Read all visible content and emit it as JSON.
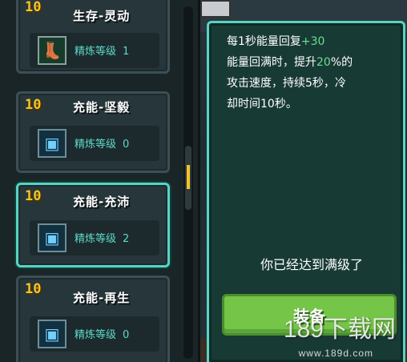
{
  "skills": [
    {
      "level": "10",
      "name": "生存-灵动",
      "refine_label": "精炼等级",
      "refine_value": "1",
      "icon": "green-boot-icon"
    },
    {
      "level": "10",
      "name": "充能-坚毅",
      "refine_label": "精炼等级",
      "refine_value": "0",
      "icon": "blue-chip-icon"
    },
    {
      "level": "10",
      "name": "充能-充沛",
      "refine_label": "精炼等级",
      "refine_value": "2",
      "icon": "blue-chip-icon"
    },
    {
      "level": "10",
      "name": "充能-再生",
      "refine_label": "精炼等级",
      "refine_value": "0",
      "icon": "blue-chip-icon"
    }
  ],
  "detail": {
    "line1_prefix": "每1秒能量回复",
    "line1_value": "+30",
    "line2_prefix": "能量回满时，提升",
    "line2_value": "20",
    "line2_suffix": "%的",
    "line3": "攻击速度，持续5秒，冷",
    "line4": "却时间10秒。",
    "maxed_text": "你已经达到满级了",
    "equip_label": "装备"
  },
  "watermark": {
    "main": "189下载网",
    "sub": "www.189d.com"
  },
  "colors": {
    "accent": "#58d3c2",
    "level": "#f3c32a",
    "highlight": "#67e08c",
    "button": "#74c548"
  }
}
